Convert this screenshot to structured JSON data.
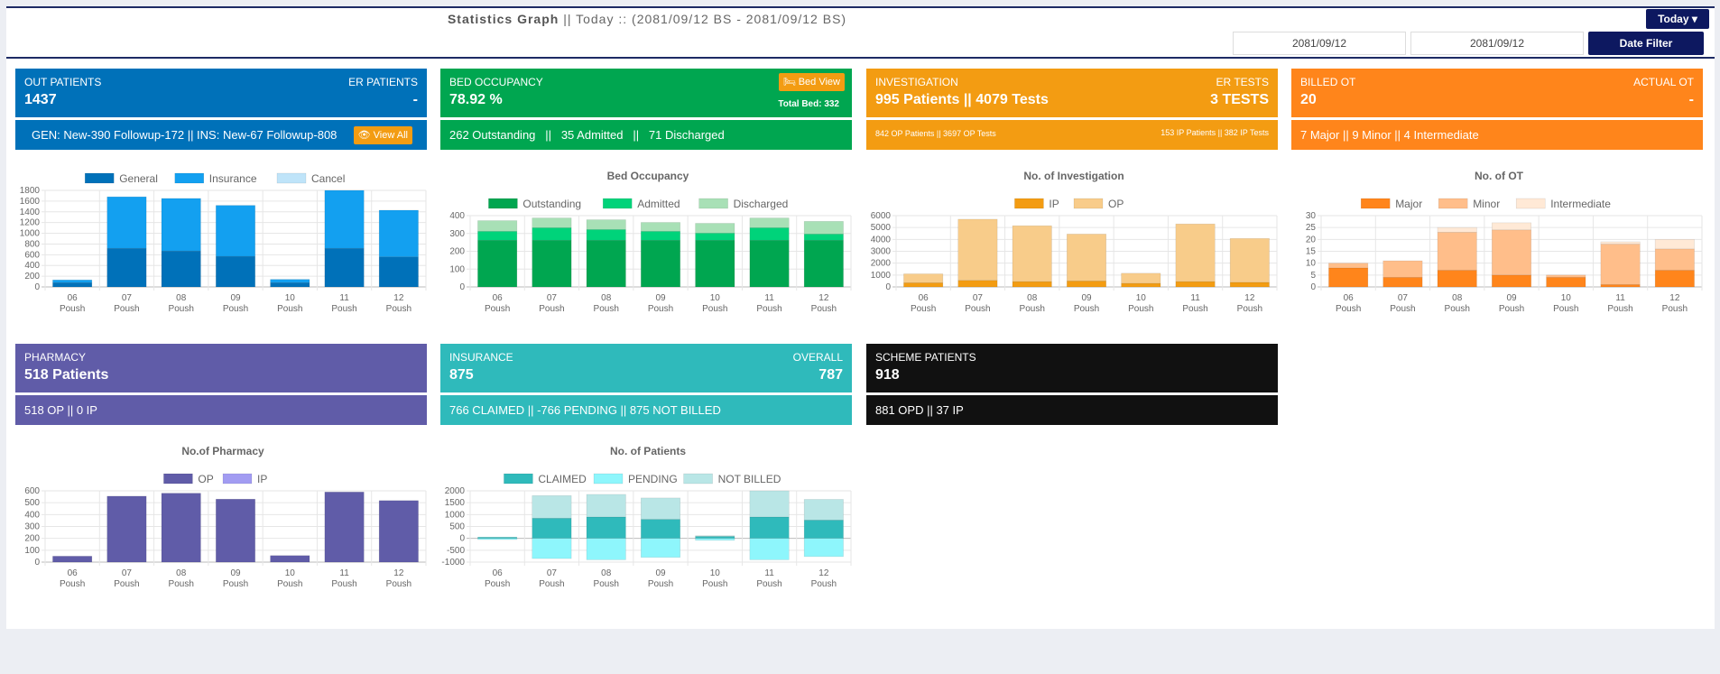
{
  "header": {
    "title_bold": "Statistics Graph",
    "title_rest": " || Today :: (2081/09/12 BS - 2081/09/12 BS)",
    "today_label": "Today",
    "date_from": "2081/09/12",
    "date_to": "2081/09/12",
    "filter_label": "Date Filter"
  },
  "cards": {
    "out": {
      "ltitle": "OUT PATIENTS",
      "lval": "1437",
      "rtitle": "ER PATIENTS",
      "rval": "-",
      "bottom": "GEN: New-390 Followup-172 || INS: New-67 Followup-808",
      "btn": "View All"
    },
    "bed": {
      "ltitle": "BED OCCUPANCY",
      "lval": "78.92 %",
      "btn": "Bed View",
      "total": "Total Bed: 332",
      "bottom": "262 Outstanding   ||   35 Admitted   ||   71 Discharged"
    },
    "inv": {
      "ltitle": "INVESTIGATION",
      "lval": "995 Patients || 4079 Tests",
      "rtitle": "ER TESTS",
      "rval": "3 TESTS",
      "bottom_left": "842 OP Patients || 3697 OP Tests",
      "bottom_right": "153 IP Patients || 382 IP Tests"
    },
    "ot": {
      "ltitle": "BILLED OT",
      "lval": "20",
      "rtitle": "ACTUAL OT",
      "rval": "-",
      "bottom": "7 Major || 9 Minor || 4 Intermediate"
    },
    "pharm": {
      "ltitle": "PHARMACY",
      "lval": "518 Patients",
      "bottom": "518 OP || 0 IP"
    },
    "ins": {
      "ltitle": "INSURANCE",
      "lval": "875",
      "rtitle": "OVERALL",
      "rval": "787",
      "bottom": "766 CLAIMED || -766 PENDING || 875 NOT BILLED"
    },
    "scheme": {
      "ltitle": "SCHEME PATIENTS",
      "lval": "918",
      "bottom": "881 OPD || 37 IP"
    }
  },
  "chart_data": [
    {
      "type": "bar",
      "id": "op",
      "title": "",
      "categories": [
        "06 Poush",
        "07 Poush",
        "08 Poush",
        "09 Poush",
        "10 Poush",
        "11 Poush",
        "12 Poush"
      ],
      "ylim": [
        0,
        1800
      ],
      "yticks": [
        0,
        200,
        400,
        600,
        800,
        1000,
        1200,
        1400,
        1600,
        1800
      ],
      "stacked": true,
      "series": [
        {
          "name": "General",
          "color": "#0071b9",
          "values": [
            80,
            720,
            670,
            570,
            80,
            720,
            560
          ]
        },
        {
          "name": "Insurance",
          "color": "#13a0f0",
          "values": [
            50,
            960,
            980,
            950,
            60,
            1080,
            870
          ]
        },
        {
          "name": "Cancel",
          "color": "#bfe4f9",
          "values": [
            0,
            0,
            0,
            0,
            0,
            0,
            0
          ]
        }
      ]
    },
    {
      "type": "bar",
      "id": "bed",
      "title": "Bed Occupancy",
      "categories": [
        "06 Poush",
        "07 Poush",
        "08 Poush",
        "09 Poush",
        "10 Poush",
        "11 Poush",
        "12 Poush"
      ],
      "ylim": [
        0,
        400
      ],
      "yticks": [
        0,
        100,
        200,
        300,
        400
      ],
      "stacked": true,
      "series": [
        {
          "name": "Outstanding",
          "color": "#00a650",
          "values": [
            262,
            262,
            262,
            262,
            262,
            262,
            262
          ]
        },
        {
          "name": "Admitted",
          "color": "#00d37a",
          "values": [
            50,
            70,
            60,
            50,
            40,
            70,
            35
          ]
        },
        {
          "name": "Discharged",
          "color": "#a8e0b6",
          "values": [
            60,
            55,
            55,
            50,
            55,
            55,
            71
          ]
        }
      ]
    },
    {
      "type": "bar",
      "id": "inv",
      "title": "No. of Investigation",
      "categories": [
        "06 Poush",
        "07 Poush",
        "08 Poush",
        "09 Poush",
        "10 Poush",
        "11 Poush",
        "12 Poush"
      ],
      "ylim": [
        0,
        6000
      ],
      "yticks": [
        0,
        1000,
        2000,
        3000,
        4000,
        5000,
        6000
      ],
      "stacked": true,
      "series": [
        {
          "name": "IP",
          "color": "#f39c12",
          "values": [
            350,
            550,
            450,
            500,
            300,
            450,
            382
          ]
        },
        {
          "name": "OP",
          "color": "#f8cc8a",
          "values": [
            750,
            5150,
            4700,
            3950,
            850,
            4850,
            3697
          ]
        }
      ]
    },
    {
      "type": "bar",
      "id": "ot",
      "title": "No. of OT",
      "categories": [
        "06 Poush",
        "07 Poush",
        "08 Poush",
        "09 Poush",
        "10 Poush",
        "11 Poush",
        "12 Poush"
      ],
      "ylim": [
        0,
        30
      ],
      "yticks": [
        0,
        5,
        10,
        15,
        20,
        25,
        30
      ],
      "stacked": true,
      "series": [
        {
          "name": "Major",
          "color": "#ff851b",
          "values": [
            8,
            4,
            7,
            5,
            4,
            1,
            7
          ]
        },
        {
          "name": "Minor",
          "color": "#ffbe8a",
          "values": [
            2,
            7,
            16,
            19,
            1,
            17,
            9
          ]
        },
        {
          "name": "Intermediate",
          "color": "#ffe9d6",
          "values": [
            0,
            0,
            2,
            3,
            0,
            1,
            4
          ]
        }
      ]
    },
    {
      "type": "bar",
      "id": "pharm",
      "title": "No.of Pharmacy",
      "categories": [
        "06 Poush",
        "07 Poush",
        "08 Poush",
        "09 Poush",
        "10 Poush",
        "11 Poush",
        "12 Poush"
      ],
      "ylim": [
        0,
        600
      ],
      "yticks": [
        0,
        100,
        200,
        300,
        400,
        500,
        600
      ],
      "stacked": true,
      "series": [
        {
          "name": "OP",
          "color": "#605ca8",
          "values": [
            50,
            555,
            580,
            530,
            55,
            590,
            518
          ]
        },
        {
          "name": "IP",
          "color": "#a29cf2",
          "values": [
            0,
            0,
            0,
            0,
            0,
            0,
            0
          ]
        }
      ]
    },
    {
      "type": "bar",
      "id": "ins",
      "title": "No. of Patients",
      "categories": [
        "06 Poush",
        "07 Poush",
        "08 Poush",
        "09 Poush",
        "10 Poush",
        "11 Poush",
        "12 Poush"
      ],
      "ylim": [
        -1000,
        2000
      ],
      "yticks": [
        -1000,
        -500,
        0,
        500,
        1000,
        1500,
        2000
      ],
      "stacked": true,
      "series": [
        {
          "name": "CLAIMED",
          "color": "#2fbabb",
          "values": [
            50,
            850,
            900,
            800,
            80,
            900,
            766
          ]
        },
        {
          "name": "PENDING",
          "color": "#8ef6fc",
          "values": [
            -50,
            -850,
            -900,
            -800,
            -80,
            -900,
            -766
          ]
        },
        {
          "name": "NOT BILLED",
          "color": "#b9e6e6",
          "values": [
            0,
            950,
            950,
            900,
            30,
            1100,
            875
          ]
        }
      ]
    }
  ]
}
